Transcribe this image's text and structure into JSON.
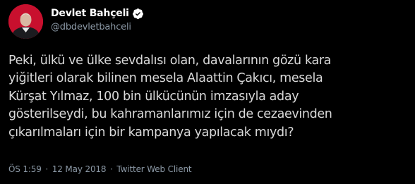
{
  "author": {
    "display_name": "Devlet Bahçeli",
    "handle": "@dbdevletbahceli",
    "verified": true,
    "avatar_icon": "profile-photo-avatar",
    "verified_icon": "verified-badge-icon"
  },
  "tweet": {
    "text": "Peki, ülkü ve ülke sevdalısı olan, davalarının gözü kara\nyiğitleri olarak bilinen mesela Alaattin Çakıcı, mesela\nKürşat Yılmaz, 100 bin ülkücünün imzasıyla aday\ngösterilseydi, bu kahramanlarımız için de cezaevinden\nçıkarılmaları için bir kampanya yapılacak mıydı?"
  },
  "meta": {
    "time": "ÖS 1:59",
    "date": "12 May 2018",
    "client": "Twitter Web Client",
    "separator": "·"
  },
  "colors": {
    "background": "#000000",
    "name": "#ffffff",
    "body_text": "#d9d9d9",
    "secondary_text": "#8b98a5",
    "verified_blue": "#ffffff"
  }
}
